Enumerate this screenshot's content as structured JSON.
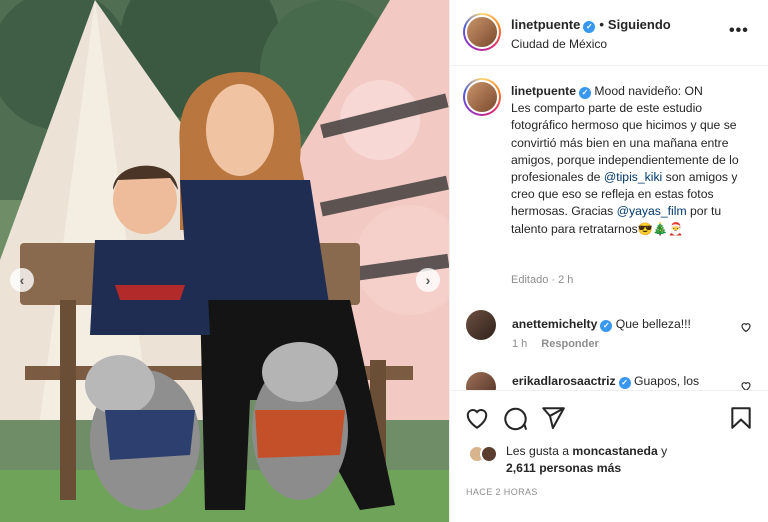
{
  "post": {
    "username": "linetpuente",
    "follow_state": "Siguiendo",
    "location": "Ciudad de México"
  },
  "caption": {
    "username": "linetpuente",
    "text_1": "Mood navideño: ON",
    "text_2": "Les comparto parte de este estudio fotográfico hermoso que hicimos y que se convirtió más bien en una mañana entre amigos, porque independientemente de lo profesionales de ",
    "mention_1": "@tipis_kiki",
    "text_3": " son amigos y creo que eso se refleja en estas fotos hermosas. Gracias ",
    "mention_2": "@yayas_film",
    "text_4": " por tu talento para retratarnos😎🎄🎅",
    "edited": "Editado",
    "time": "2 h"
  },
  "comments": [
    {
      "username": "anettemichelty",
      "text": "Que belleza!!!",
      "time": "1 h",
      "reply": "Responder"
    },
    {
      "username": "erikadlarosaactriz",
      "text": "Guapos, los"
    }
  ],
  "likes": {
    "prefix": "Les gusta a ",
    "user": "moncastaneda",
    "middle": " y",
    "count": "2,611 personas más"
  },
  "time_ago": "HACE 2 HORAS",
  "icons": {
    "prev": "chevron-left-icon",
    "next": "chevron-right-icon",
    "more": "more-options-icon",
    "like": "heart-icon",
    "comment": "comment-icon",
    "share": "share-icon",
    "save": "bookmark-icon"
  },
  "colors": {
    "verified": "#3897f0",
    "mention": "#00376b",
    "muted": "#8e8e8e",
    "border": "#efefef"
  }
}
